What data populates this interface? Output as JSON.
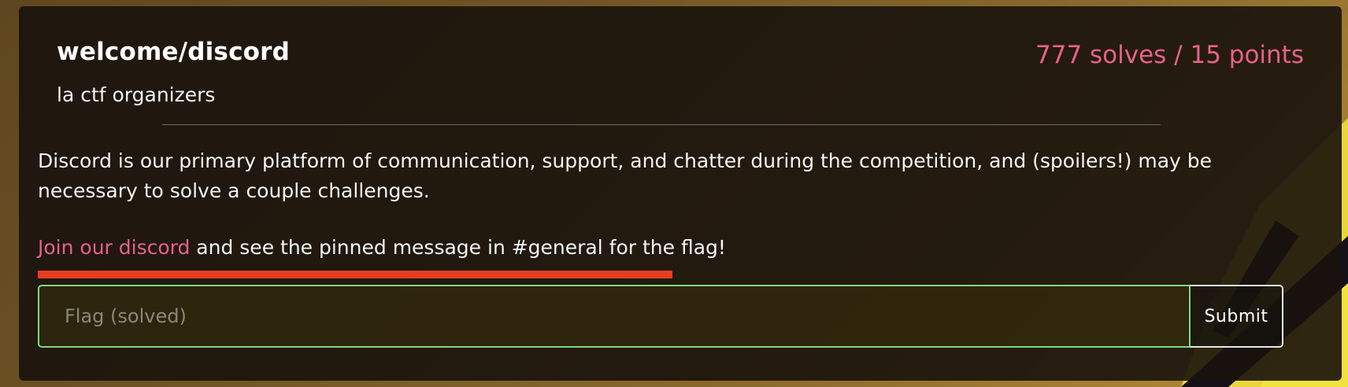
{
  "challenge": {
    "title": "welcome/discord",
    "author": "la ctf organizers",
    "stats": "777 solves / 15 points",
    "description": "Discord is our primary platform of communication, support, and chatter during the competition, and (spoilers!) may be necessary to solve a couple challenges.",
    "join": {
      "link_text": "Join our discord",
      "rest_text": " and see the pinned message in #general for the flag!"
    }
  },
  "flag_form": {
    "placeholder": "Flag (solved)",
    "submit_label": "Submit"
  },
  "colors": {
    "accent_pink": "#e8608a",
    "highlight_red": "#e53d20",
    "solved_green": "#7dd87a"
  }
}
